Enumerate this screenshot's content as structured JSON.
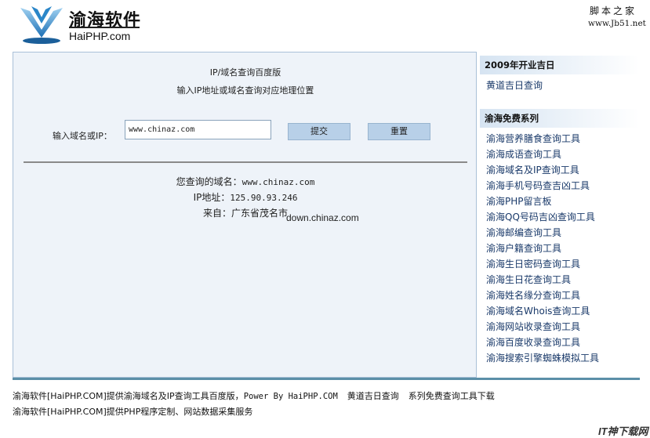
{
  "header": {
    "brand_title": "渝海软件",
    "brand_url": "HaiPHP.com",
    "corner_title": "脚本之家",
    "corner_url": "www.Jb51.net"
  },
  "tool": {
    "title": "IP/域名查询百度版",
    "subtitle": "输入IP地址或域名查询对应地理位置",
    "input_label": "输入域名或IP：",
    "input_value": "www.chinaz.com",
    "submit_label": "提交",
    "reset_label": "重置"
  },
  "result": {
    "domain_label": "您查询的域名：",
    "domain_value": "www.chinaz.com",
    "ip_label": "IP地址：",
    "ip_value": "125.90.93.246",
    "location_label": "来自：",
    "location_value": "广东省茂名市"
  },
  "watermark": "down.chinaz.com",
  "sidebar": {
    "section1_title": "2009年开业吉日",
    "section1_items": [
      "黄道吉日查询"
    ],
    "section2_title": "渝海免费系列",
    "section2_items": [
      "渝海营养膳食查询工具",
      "渝海成语查询工具",
      "渝海域名及IP查询工具",
      "渝海手机号码查吉凶工具",
      "渝海PHP留言板",
      "渝海QQ号码吉凶查询工具",
      "渝海邮编查询工具",
      "渝海户籍查询工具",
      "渝海生日密码查询工具",
      "渝海生日花查询工具",
      "渝海姓名缘分查询工具",
      "渝海域名Whois查询工具",
      "渝海网站收录查询工具",
      "渝海百度收录查询工具",
      "渝海搜索引擎蜘蛛模拟工具"
    ]
  },
  "footer": {
    "line1_prefix": "渝海软件[HaiPHP.COM]提供渝海域名及IP查询工具百度版，",
    "line1_power": "Power By HaiPHP.COM",
    "line1_link1": "黄道吉日查询",
    "line1_link2": "系列免费查询工具下载",
    "line2": "渝海软件[HaiPHP.COM]提供PHP程序定制、网站数据采集服务"
  },
  "corner_logo": "IT神下载网"
}
